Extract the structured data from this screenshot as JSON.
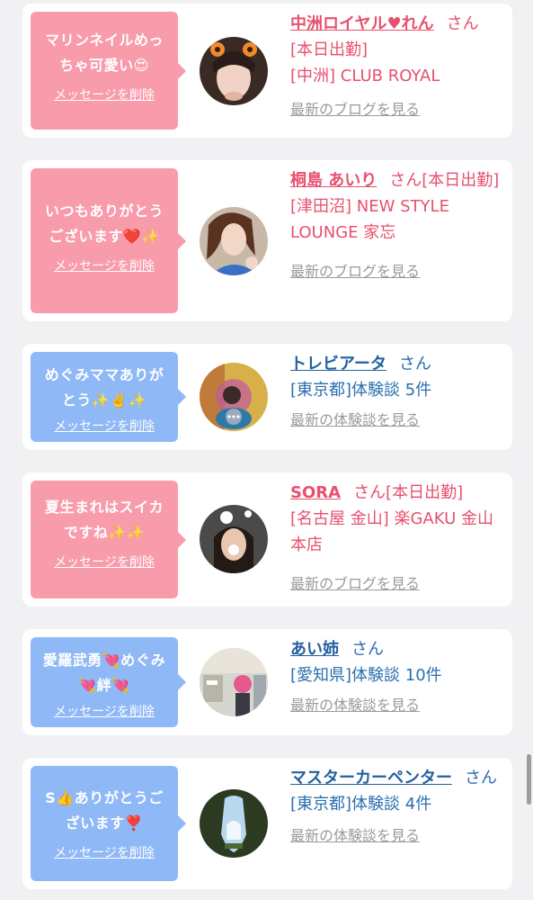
{
  "entries": [
    {
      "message": "マリンネイルめっちゃ可愛い😍",
      "delete_label": "メッセージを削除",
      "name": "中洲ロイヤル♥れん",
      "suffix": "さん",
      "status": "[本日出勤]",
      "detail": "[中洲] CLUB ROYAL",
      "link": "最新のブログを見る",
      "bubble_color": "#f89bab",
      "avatar_icon": "woman-with-cat-ears-icon"
    },
    {
      "message": "いつもありがとうございます❤️✨",
      "delete_label": "メッセージを削除",
      "name": "桐島 あいり",
      "suffix": "さん[本日出勤]",
      "status": "",
      "detail": "[津田沼] NEW STYLE LOUNGE 家忘",
      "link": "最新のブログを見る",
      "bubble_color": "#f89bab",
      "avatar_icon": "woman-portrait-icon"
    },
    {
      "message": "めぐみママありがとう✨✌️✨",
      "delete_label": "メッセージを削除",
      "name": "トレビアータ",
      "suffix": "さん",
      "status": "",
      "detail": "[東京都]体験談 5件",
      "link": "最新の体験談を見る",
      "bubble_color": "#8fb8f6",
      "avatar_icon": "blurred-photo-icon"
    },
    {
      "message": "夏生まれはスイカですね✨✨",
      "delete_label": "メッセージを削除",
      "name": "SORA",
      "suffix": "さん[本日出勤]",
      "status": "",
      "detail": "[名古屋 金山] 楽GAKU 金山本店",
      "link": "最新のブログを見る",
      "bubble_color": "#f89bab",
      "avatar_icon": "woman-with-bunny-stickers-icon"
    },
    {
      "message": "愛羅武勇💘めぐみ💘絆💘",
      "delete_label": "メッセージを削除",
      "name": "あい姉",
      "suffix": "さん",
      "status": "",
      "detail": "[愛知県]体験談 10件",
      "link": "最新の体験談を見る",
      "bubble_color": "#8fb8f6",
      "avatar_icon": "street-photo-icon"
    },
    {
      "message": "S👍ありがとうございます❣️",
      "delete_label": "メッセージを削除",
      "name": "マスターカーペンター",
      "suffix": "さん",
      "status": "",
      "detail": "[東京都]体験談 4件",
      "link": "最新の体験談を見る",
      "bubble_color": "#8fb8f6",
      "avatar_icon": "forest-sky-icon"
    }
  ]
}
